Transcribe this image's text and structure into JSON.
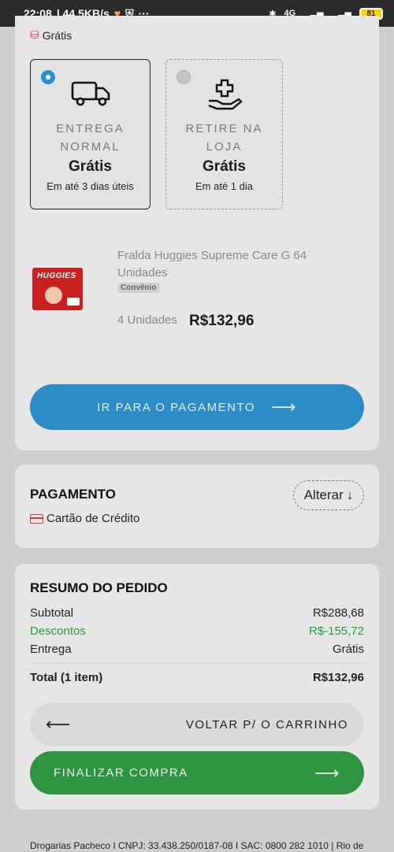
{
  "status_bar": {
    "time": "22:08",
    "speed": "| 44,5KB/s",
    "network": "4G",
    "battery": "81"
  },
  "delivery": {
    "shipping_label": "Grátis",
    "options": [
      {
        "title": "ENTREGA NORMAL",
        "price": "Grátis",
        "sub": "Em até 3 dias úteis",
        "selected": true,
        "icon": "truck-icon"
      },
      {
        "title": "RETIRE NA LOJA",
        "price": "Grátis",
        "sub": "Em até 1 dia",
        "selected": false,
        "icon": "pickup-hand-icon"
      }
    ]
  },
  "product": {
    "name": "Fralda Huggies Supreme Care G 64 Unidades",
    "badge": "Convênio",
    "quantity": "4 Unidades",
    "price": "R$132,96",
    "image_brand": "HUGGIES"
  },
  "pay_button": "IR PARA O PAGAMENTO",
  "payment": {
    "title": "PAGAMENTO",
    "change": "Alterar",
    "method": "Cartão de Crédito"
  },
  "summary": {
    "title": "RESUMO DO PEDIDO",
    "subtotal_label": "Subtotal",
    "subtotal_value": "R$288,68",
    "discount_label": "Descontos",
    "discount_value": "R$-155,72",
    "delivery_label": "Entrega",
    "delivery_value": "Grátis",
    "total_label": "Total (1 item)",
    "total_value": "R$132,96",
    "back_button": "VOLTAR P/ O CARRINHO",
    "finish_button": "FINALIZAR COMPRA"
  },
  "footer": "Drogarias Pacheco I CNPJ: 33.438.250/0187-08 I SAC: 0800 282 1010 | Rio de",
  "colors": {
    "accent_blue": "#2b8cc6",
    "accent_green": "#2f9441",
    "discount_green": "#2d9a3b"
  }
}
